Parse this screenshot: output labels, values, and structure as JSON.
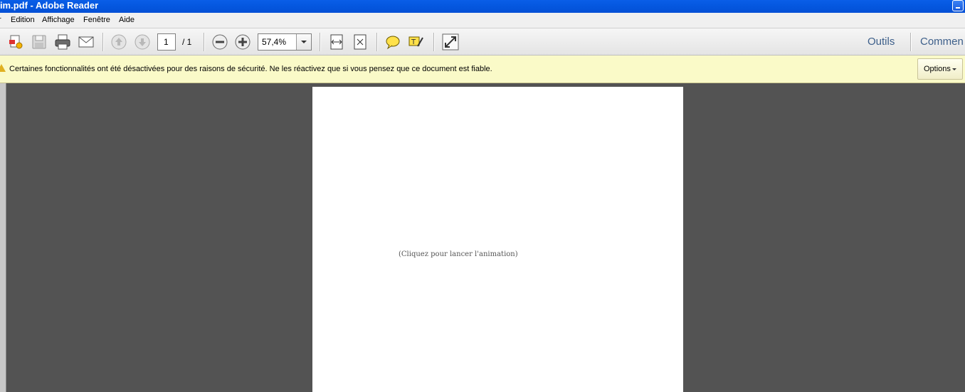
{
  "window": {
    "title": "nim.pdf - Adobe Reader"
  },
  "menu": [
    "r",
    "Edition",
    "Affichage",
    "Fenêtre",
    "Aide"
  ],
  "toolbar": {
    "icons": [
      "create-pdf-icon",
      "save-icon",
      "print-icon",
      "email-icon",
      "page-up-icon",
      "page-down-icon",
      "zoom-out-icon",
      "zoom-in-icon",
      "fit-width-icon",
      "fit-page-icon",
      "comment-icon",
      "highlight-icon",
      "fullscreen-icon"
    ],
    "page_current": "1",
    "page_total": "/ 1",
    "zoom": "57,4%",
    "tabs": {
      "tools": "Outils",
      "comment": "Commen"
    }
  },
  "security_bar": {
    "message": "Certaines fonctionnalités ont été désactivées pour des raisons de sécurité. Ne les réactivez que si vous pensez que ce document est fiable.",
    "options_label": "Options"
  },
  "document": {
    "text": "(Cliquez pour lancer l'animation)"
  },
  "colors": {
    "titlebar": "#0558e0",
    "security_bg": "#fafac8",
    "workspace": "#535353",
    "accent": "#3d5f8a"
  }
}
